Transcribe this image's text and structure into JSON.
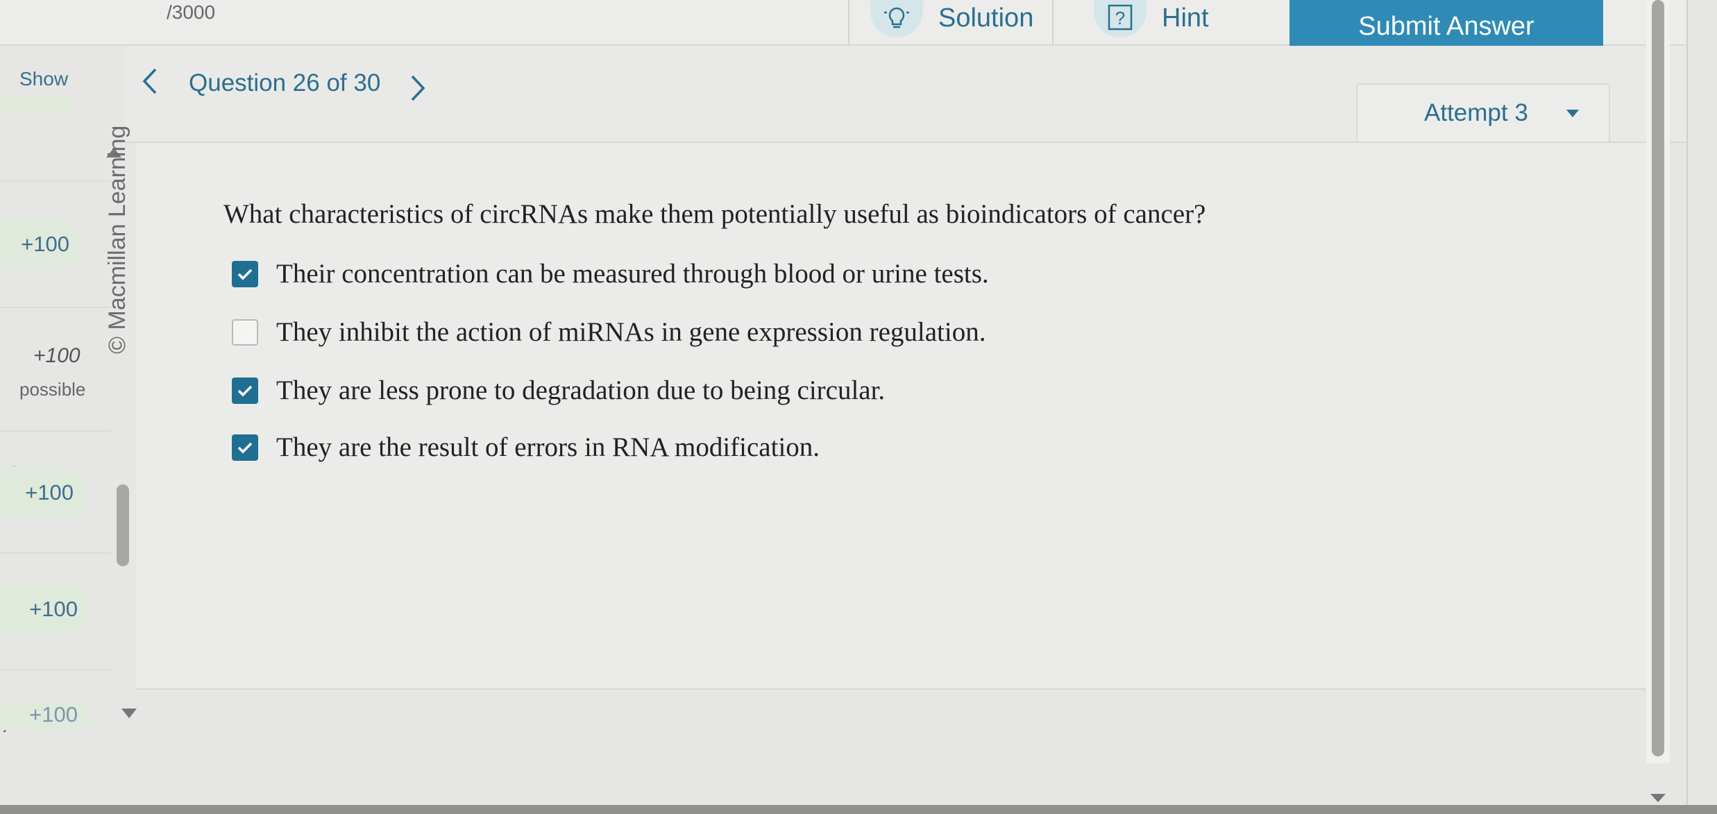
{
  "toolbar": {
    "points_total": "/3000",
    "solution_label": "Solution",
    "hint_label": "Hint",
    "hint_glyph": "?",
    "submit_label": "Submit Answer"
  },
  "nav": {
    "show_label": "Show",
    "question_counter": "Question 26 of 30",
    "attempt_label": "Attempt 3"
  },
  "sidebar": {
    "pills": [
      "+100",
      "+100",
      "+100",
      "+100"
    ],
    "possible_points": "+100",
    "possible_label": "possible"
  },
  "content": {
    "copyright": "© Macmillan Learning",
    "question": "What characteristics of circRNAs make them potentially useful as bioindicators of cancer?",
    "options": [
      {
        "text": "Their concentration can be measured through blood or urine tests.",
        "checked": true
      },
      {
        "text": "They inhibit the action of miRNAs in gene expression regulation.",
        "checked": false
      },
      {
        "text": "They are less prone to degradation due to being circular.",
        "checked": true
      },
      {
        "text": "They are the result of errors in RNA modification.",
        "checked": true
      }
    ]
  },
  "icons": {
    "solution": "lightbulb-icon",
    "hint": "question-box-icon",
    "prev": "chevron-left-icon",
    "next": "chevron-right-icon",
    "dropdown": "caret-down-icon",
    "check": "checkmark-icon"
  },
  "colors": {
    "accent": "#2f8bb6",
    "link": "#2a6f8f",
    "checkbox_checked": "#1f6f92",
    "pill_bg": "#dfe9dc"
  }
}
